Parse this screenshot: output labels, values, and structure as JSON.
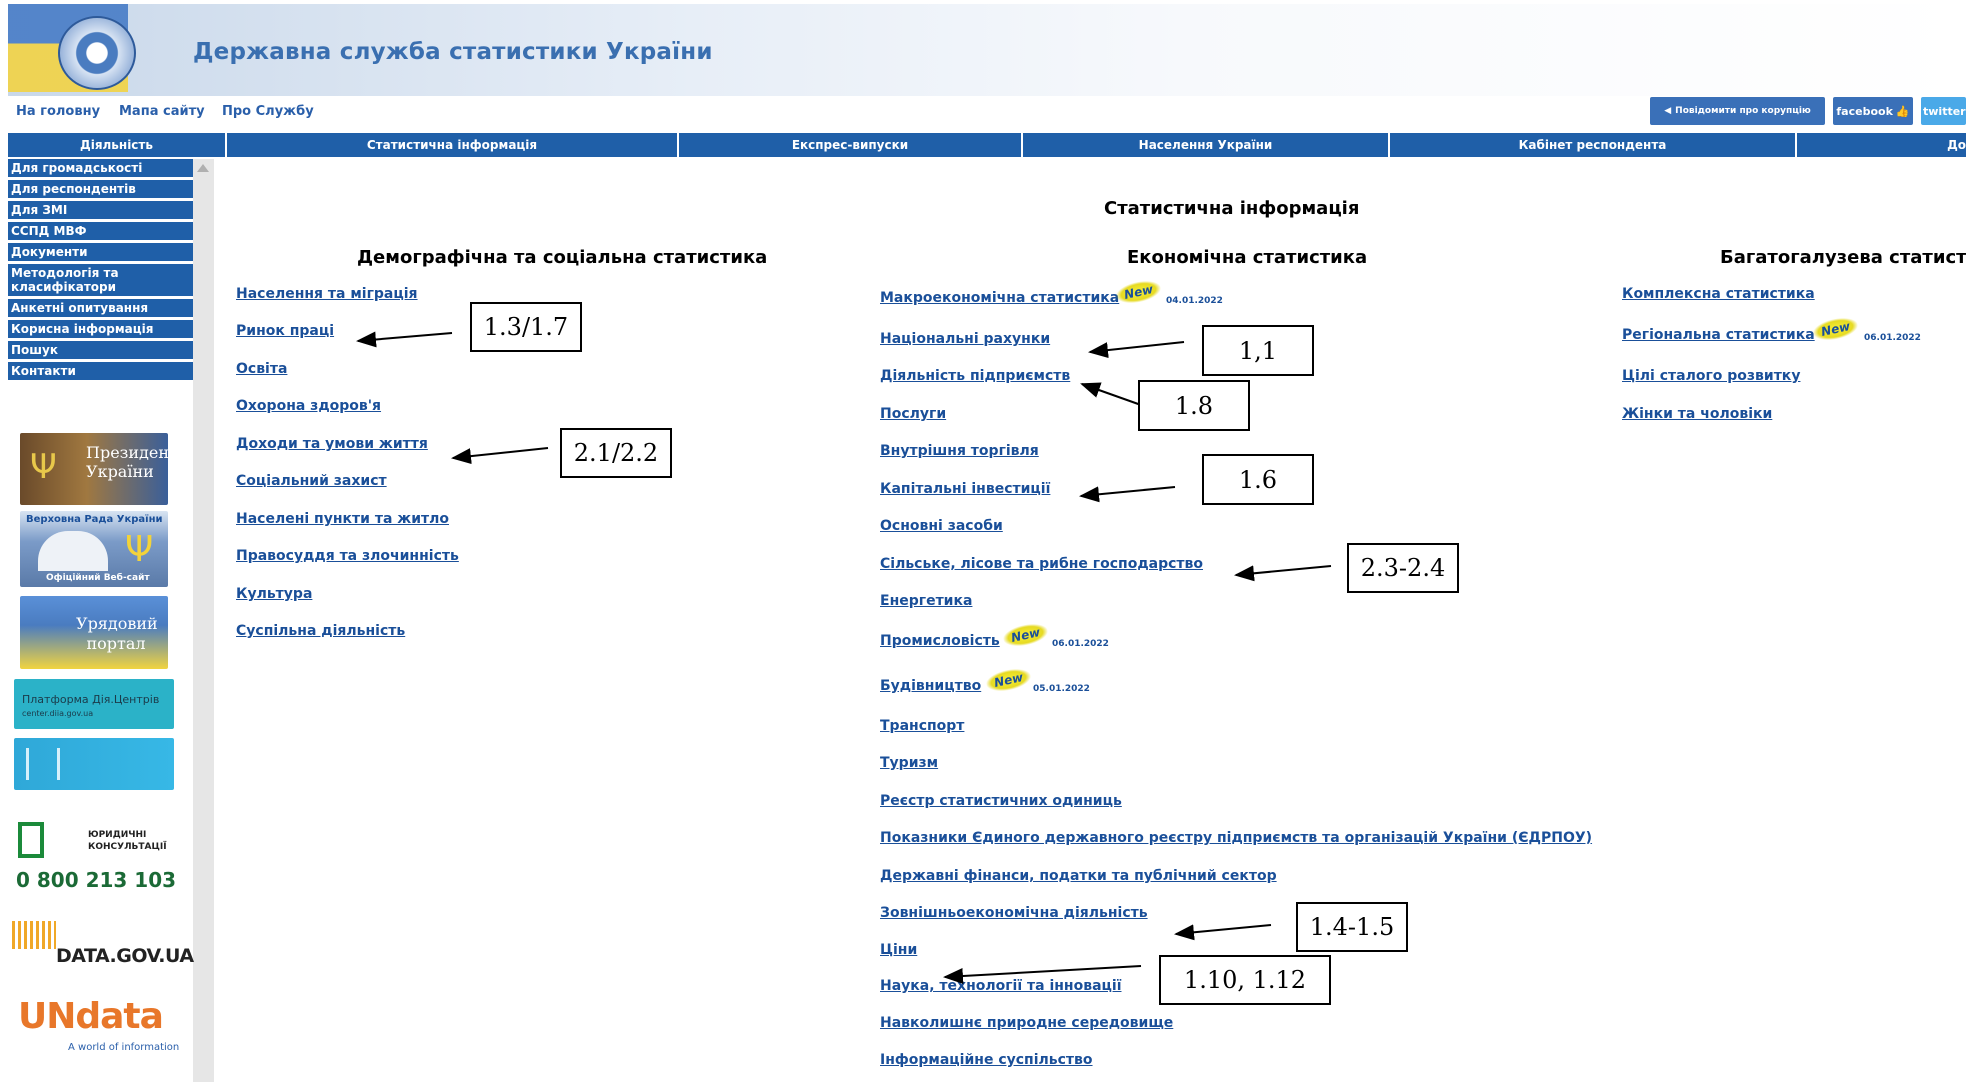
{
  "header": {
    "site_title": "Державна служба статистики України",
    "links": [
      "На головну",
      "Мапа сайту",
      "Про Службу"
    ],
    "buttons": [
      "Повідомити про корупцію",
      "facebook",
      "twitter"
    ]
  },
  "nav": {
    "tabs": [
      "Діяльність",
      "Статистична інформація",
      "Експрес-випуски",
      "Населення України",
      "Кабінет респондента",
      "До"
    ]
  },
  "sidebar": {
    "items": [
      "Для громадськості",
      "Для респондентів",
      "Для ЗМІ",
      "ССПД МВФ",
      "Документи",
      "Методологія та класифікатори",
      "Анкетні опитування",
      "Корисна інформація",
      "Пошук",
      "Контакти"
    ],
    "banners": {
      "president": "Президент України",
      "rada": "Верховна Рада України",
      "rada_sub": "Офіційний Веб-сайт",
      "gov": "Урядовий портал",
      "dia": "Платформа Дія.Центрів",
      "dia_sub": "center.diia.gov.ua",
      "legal_line1": "ЮРИДИЧНІ",
      "legal_line2": "КОНСУЛЬТАЦІЇ",
      "legal_phone": "0 800 213 103",
      "datagov": "DATA.GOV.UA",
      "undata": "UNdata",
      "undata_sub": "A world of information"
    }
  },
  "main": {
    "title": "Статистична інформація",
    "columns": {
      "demographic": {
        "heading": "Демографічна та соціальна статистика",
        "links": [
          "Населення та міграція",
          "Ринок праці",
          "Освіта",
          "Охорона здоров'я",
          "Доходи та умови життя",
          "Соціальний захист",
          "Населені пункти та житло",
          "Правосуддя та злочинність",
          "Культура",
          "Суспільна діяльність"
        ]
      },
      "economic": {
        "heading": "Економічна статистика",
        "links": [
          "Макроекономічна статистика",
          "Національні рахунки",
          "Діяльність підприємств",
          "Послуги",
          "Внутрішня торгівля",
          "Капітальні інвестиції",
          "Основні засоби",
          "Сільське, лісове та рибне господарство",
          "Енергетика",
          "Промисловість",
          "Будівництво",
          "Транспорт",
          "Туризм",
          "Реєстр статистичних одиниць",
          "Показники Єдиного державного реєстру підприємств та організацій України (ЄДРПОУ)",
          "Державні фінанси, податки та публічний сектор",
          "Зовнішньоекономічна діяльність",
          "Ціни",
          "Наука, технології та інновації",
          "Навколишнє природне середовище",
          "Інформаційне суспільство"
        ],
        "new_badge": "New",
        "dates": {
          "macro": "04.01.2022",
          "industry": "06.01.2022",
          "construction": "05.01.2022"
        }
      },
      "multisector": {
        "heading": "Багатогалузева статист",
        "links": [
          "Комплексна статистика",
          "Регіональна статистика",
          "Цілі сталого розвитку",
          "Жінки та чоловіки"
        ],
        "new_badge": "New",
        "date": "06.01.2022"
      }
    }
  },
  "annotations": [
    "1.3/1.7",
    "2.1/2.2",
    "1,1",
    "1.8",
    "1.6",
    "2.3-2.4",
    "1.4-1.5",
    "1.10, 1.12"
  ]
}
